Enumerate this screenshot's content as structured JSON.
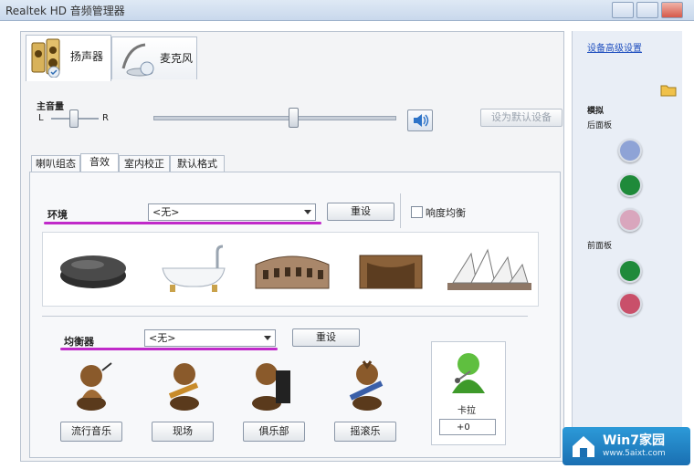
{
  "window": {
    "title": "Realtek HD 音频管理器"
  },
  "device_tabs": [
    {
      "label": "扬声器"
    },
    {
      "label": "麦克风"
    }
  ],
  "volume": {
    "label": "主音量",
    "left_label": "L",
    "right_label": "R",
    "set_default_button": "设为默认设备"
  },
  "sub_tabs": [
    {
      "label": "喇叭组态"
    },
    {
      "label": "音效"
    },
    {
      "label": "室内校正"
    },
    {
      "label": "默认格式"
    }
  ],
  "environment": {
    "label": "环境",
    "selected": "<无>",
    "reset_button": "重设",
    "loudness_label": "响度均衡"
  },
  "equalizer": {
    "label": "均衡器",
    "selected": "<无>",
    "reset_button": "重设",
    "presets": [
      {
        "label": "流行音乐"
      },
      {
        "label": "现场"
      },
      {
        "label": "俱乐部"
      },
      {
        "label": "摇滚乐"
      }
    ],
    "karaoke_label": "卡拉",
    "karaoke_value": "+0"
  },
  "right_panel": {
    "link": "设备高级设置",
    "analog_label": "模拟",
    "rear_label": "后面板",
    "front_label": "前面板",
    "colors": {
      "rear": [
        "#8ea3d6",
        "#1f8a3a",
        "#d9a6bd"
      ],
      "front": [
        "#1f8a3a",
        "#c9506a"
      ]
    }
  },
  "watermark": {
    "title": "Win7家园",
    "url": "www.5aixt.com"
  }
}
